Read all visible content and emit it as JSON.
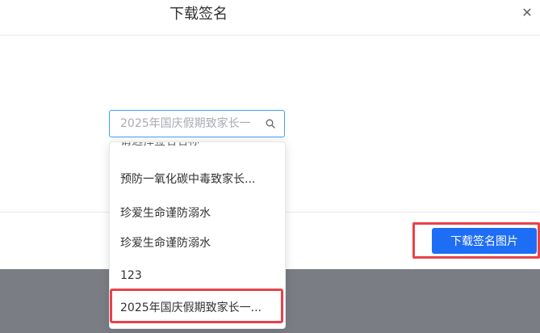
{
  "modal": {
    "title": "下载签名",
    "close_icon": "close-icon",
    "select": {
      "value": "2025年国庆假期致家长一",
      "icon": "search-icon"
    },
    "dropdown": {
      "partial_label": "请选择签名名称",
      "options": [
        "预防一氧化碳中毒致家长...",
        "珍爱生命谨防溺水",
        "珍爱生命谨防溺水",
        "123",
        "2025年国庆假期致家长一..."
      ]
    },
    "download_button": "下载签名图片"
  },
  "colors": {
    "primary": "#1d6ef5",
    "highlight": "#e8424a",
    "overlay": "#7a7d83"
  }
}
